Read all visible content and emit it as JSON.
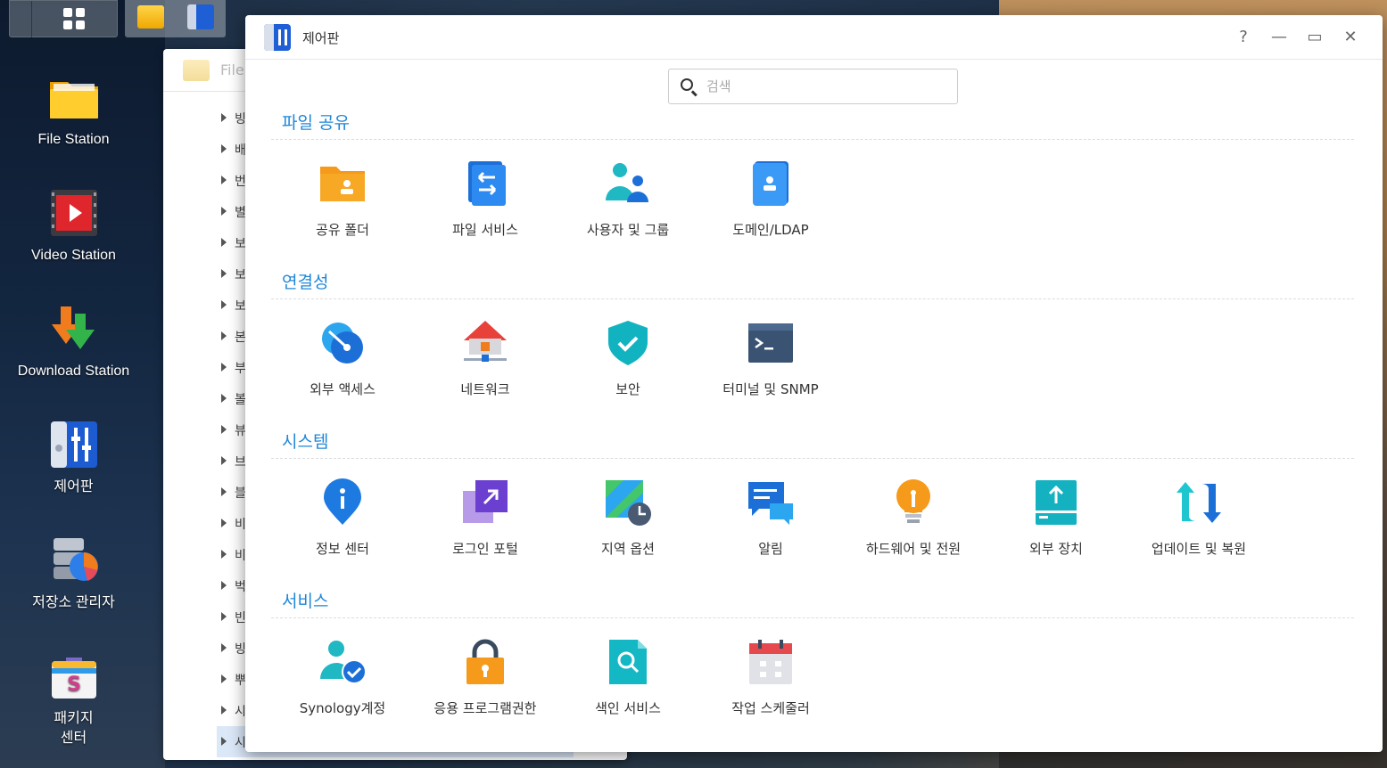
{
  "taskbar": {},
  "desktop": {
    "items": [
      {
        "label": "File Station"
      },
      {
        "label": "Video Station"
      },
      {
        "label": "Download Station"
      },
      {
        "label": "제어판"
      },
      {
        "label": "저장소 관리자"
      },
      {
        "label": "패키지",
        "label2": "센터"
      }
    ]
  },
  "file_station": {
    "title": "File",
    "rows": [
      "빙",
      "배",
      "번",
      "별",
      "보",
      "보",
      "보",
      "본",
      "부",
      "볼",
      "뷰",
      "브",
      "블",
      "비",
      "비",
      "벅",
      "빈",
      "빙",
      "뿌",
      "시",
      "시"
    ]
  },
  "control_panel": {
    "title": "제어판",
    "window_buttons": {
      "help": "?",
      "minimize": "—",
      "maximize": "▭",
      "close": "✕"
    },
    "search": {
      "placeholder": "검색",
      "value": ""
    },
    "sections": [
      {
        "title": "파일 공유",
        "items": [
          "공유 폴더",
          "파일 서비스",
          "사용자 및 그룹",
          "도메인/LDAP"
        ]
      },
      {
        "title": "연결성",
        "items": [
          "외부 액세스",
          "네트워크",
          "보안",
          "터미널 및 SNMP"
        ]
      },
      {
        "title": "시스템",
        "items": [
          "정보 센터",
          "로그인 포털",
          "지역 옵션",
          "알림",
          "하드웨어 및 전원",
          "외부 장치",
          "업데이트 및 복원"
        ]
      },
      {
        "title": "서비스",
        "items": [
          "Synology계정",
          "응용 프로그램권한",
          "색인 서비스",
          "작업 스케줄러"
        ]
      }
    ]
  },
  "colors": {
    "accent": "#1f87d8",
    "folder": "#f7a825"
  }
}
